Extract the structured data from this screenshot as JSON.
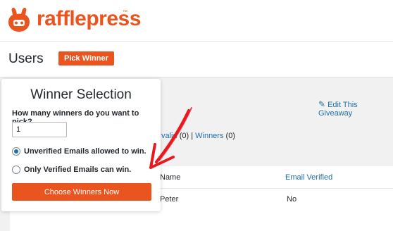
{
  "brand": {
    "name": "rafflepress",
    "tm": "™",
    "color": "#e9541f"
  },
  "header": {
    "title": "Users",
    "pick_winner_label": "Pick Winner"
  },
  "page": {
    "edit_link": "Edit This Giveaway",
    "filters": {
      "invalid_label": "valid",
      "invalid_count": "(0)",
      "separator": "|",
      "winners_label": "Winners",
      "winners_count": "(0)"
    }
  },
  "table": {
    "columns": [
      "Name",
      "Email Verified"
    ],
    "rows": [
      {
        "name": "Peter",
        "email_verified": "No"
      }
    ]
  },
  "modal": {
    "title": "Winner Selection",
    "question": "How many winners do you want to pick?",
    "winners_count_value": "1",
    "options": [
      {
        "label": "Unverified Emails allowed to win.",
        "selected": true
      },
      {
        "label": "Only Verified Emails can win.",
        "selected": false
      }
    ],
    "submit_label": "Choose Winners Now"
  },
  "annotation": {
    "arrow_color": "#e8191f"
  }
}
